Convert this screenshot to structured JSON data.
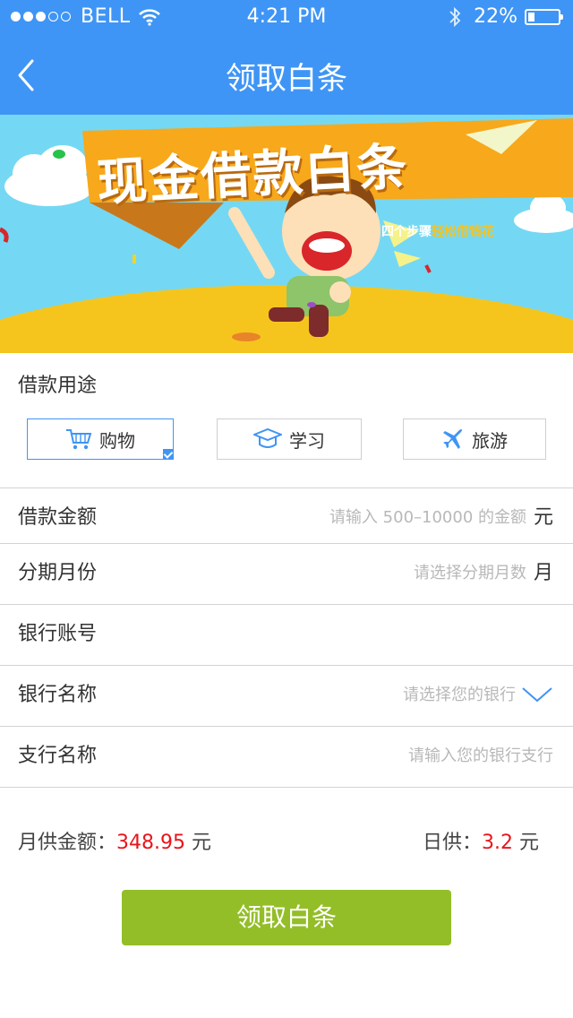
{
  "status_bar": {
    "carrier": "BELL",
    "signal_bars_filled": 3,
    "signal_bars_total": 5,
    "time": "4:21 PM",
    "battery_percent": "22%",
    "battery_level": 0.22
  },
  "nav": {
    "title": "领取白条",
    "back_icon": "chevron-left-icon"
  },
  "banner": {
    "headline": "现金借款白条",
    "tagline_white": "四个步骤",
    "tagline_yellow": "轻松借钱花"
  },
  "purpose": {
    "label": "借款用途",
    "options": [
      {
        "label": "购物",
        "icon": "shopping-cart-icon",
        "selected": true
      },
      {
        "label": "学习",
        "icon": "graduation-cap-icon",
        "selected": false
      },
      {
        "label": "旅游",
        "icon": "airplane-icon",
        "selected": false
      }
    ]
  },
  "form": {
    "amount": {
      "label": "借款金额",
      "placeholder": "请输入 500–10000 的金额",
      "unit": "元"
    },
    "months": {
      "label": "分期月份",
      "placeholder": "请选择分期月数",
      "unit": "月"
    },
    "account": {
      "label": "银行账号",
      "value": ""
    },
    "bank_name": {
      "label": "银行名称",
      "placeholder": "请选择您的银行",
      "icon": "chevron-down-icon"
    },
    "branch": {
      "label": "支行名称",
      "placeholder": "请输入您的银行支行"
    }
  },
  "summary": {
    "monthly_label": "月供金额：",
    "monthly_value": "348.95",
    "monthly_unit": "元",
    "daily_label": "日供：",
    "daily_value": "3.2",
    "daily_unit": "元"
  },
  "submit_label": "领取白条",
  "colors": {
    "header_bg": "#3f95f5",
    "accent_blue": "#3f95f5",
    "submit_green": "#93be28",
    "highlight_red": "#e8151b",
    "banner_orange": "#f7a81b",
    "banner_sky": "#74d8f4"
  }
}
